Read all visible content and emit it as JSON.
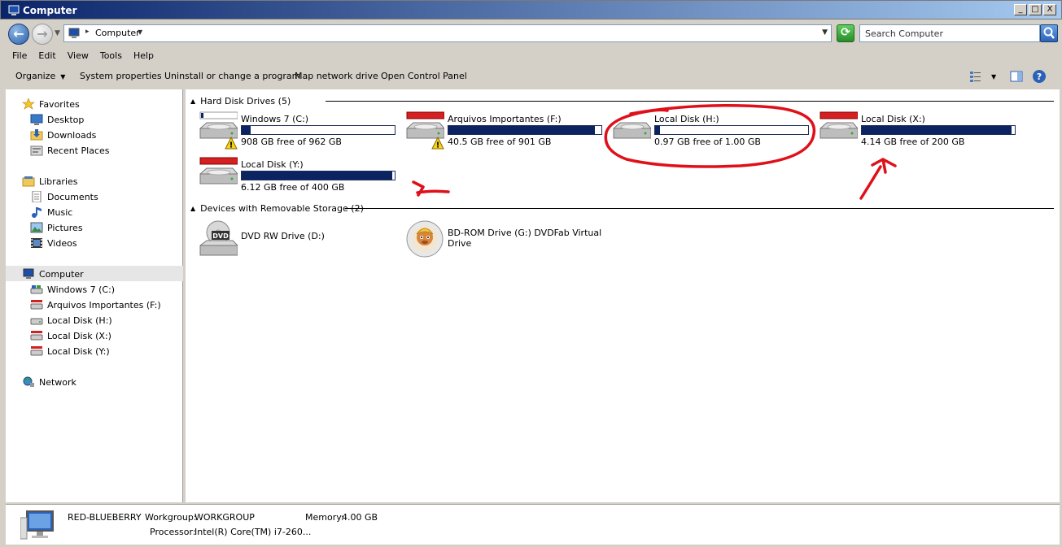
{
  "window": {
    "title": "Computer",
    "btn_min": "_",
    "btn_max": "□",
    "btn_close": "X"
  },
  "address": {
    "path": "Computer",
    "search_placeholder": "Search Computer"
  },
  "menu": [
    "File",
    "Edit",
    "View",
    "Tools",
    "Help"
  ],
  "toolbar": {
    "organize": "Organize",
    "system_properties": "System properties",
    "uninstall": "Uninstall or change a program",
    "map_drive": "Map network drive",
    "control_panel": "Open Control Panel"
  },
  "sidebar": {
    "favorites": "Favorites",
    "desktop": "Desktop",
    "downloads": "Downloads",
    "recent": "Recent Places",
    "libraries": "Libraries",
    "documents": "Documents",
    "music": "Music",
    "pictures": "Pictures",
    "videos": "Videos",
    "computer": "Computer",
    "drive_c": "Windows 7 (C:)",
    "drive_f": "Arquivos Importantes (F:)",
    "drive_h": "Local Disk (H:)",
    "drive_x": "Local Disk (X:)",
    "drive_y": "Local Disk (Y:)",
    "network": "Network"
  },
  "groups": {
    "hdd": "Hard Disk Drives (5)",
    "removable": "Devices with Removable Storage (2)"
  },
  "drives": [
    {
      "name": "Windows 7 (C:)",
      "free": "908 GB free of 962 GB",
      "used_fraction": 0.056,
      "warn": true
    },
    {
      "name": "Arquivos Importantes (F:)",
      "free": "40.5 GB free of 901 GB",
      "used_fraction": 0.955,
      "warn": true
    },
    {
      "name": "Local Disk (H:)",
      "free": "0.97 GB free of 1.00 GB",
      "used_fraction": 0.03,
      "warn": false
    },
    {
      "name": "Local Disk (X:)",
      "free": "4.14 GB free of 200 GB",
      "used_fraction": 0.98,
      "warn": false
    },
    {
      "name": "Local Disk (Y:)",
      "free": "6.12 GB free of 400 GB",
      "used_fraction": 0.985,
      "warn": false
    }
  ],
  "removable": [
    {
      "name": "DVD RW Drive (D:)",
      "label": "DVD"
    },
    {
      "name_line1": "BD-ROM Drive (G:) DVDFab Virtual",
      "name_line2": "Drive"
    }
  ],
  "details": {
    "computer_name": "RED-BLUEBERRY",
    "workgroup_label": "Workgroup:",
    "workgroup": "WORKGROUP",
    "memory_label": "Memory:",
    "memory": "4.00 GB",
    "processor_label": "Processor:",
    "processor": "Intel(R) Core(TM) i7-260..."
  },
  "colors": {
    "bar_fill": "#0b2361",
    "annotation": "#e0101a",
    "title_bar": "#0a246a"
  }
}
